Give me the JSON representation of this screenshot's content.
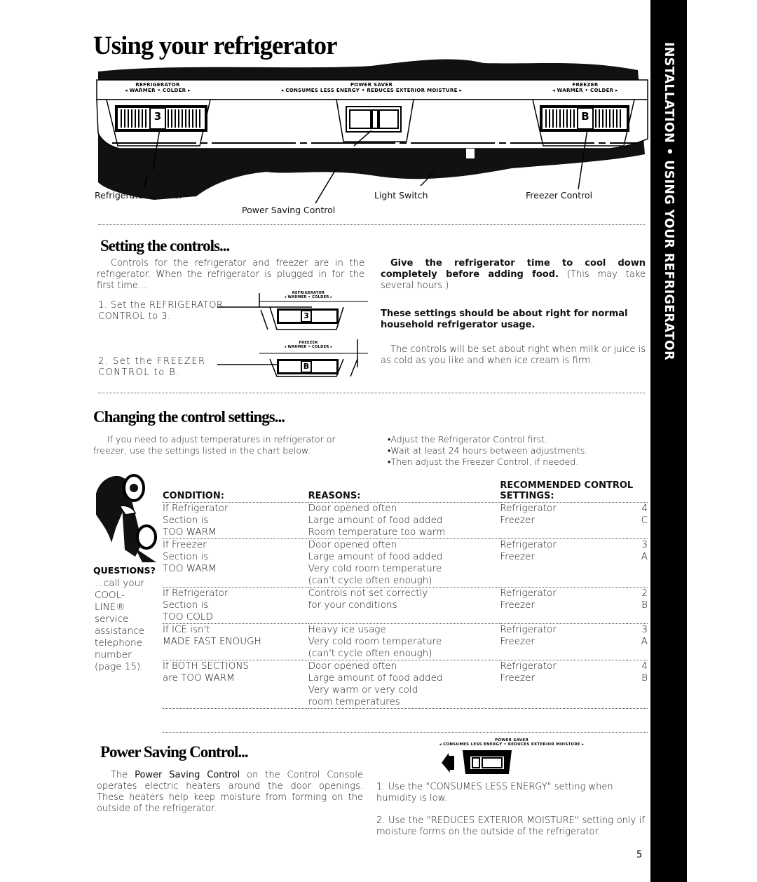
{
  "page_title": "Using your refrigerator",
  "side_tab": "INSTALLATION • USING YOUR REFRIGERATOR",
  "page_number": "5",
  "console": {
    "refrigerator_label": "REFRIGERATOR",
    "refrigerator_scale": "◂ WARMER • COLDER ▸",
    "refrigerator_setting": "3",
    "power_saver_label": "POWER SAVER",
    "power_saver_scale": "◂ CONSUMES LESS ENERGY • REDUCES EXTERIOR MOISTURE ▸",
    "freezer_label": "FREEZER",
    "freezer_scale": "◂ WARMER • COLDER ▸",
    "freezer_setting": "B",
    "callouts": {
      "refrigerator_control": "Refrigerator Control",
      "power_saving_control": "Power Saving Control",
      "light_switch": "Light Switch",
      "freezer_control": "Freezer Control"
    }
  },
  "setting_controls": {
    "heading": "Setting the controls...",
    "intro": "Controls for the refrigerator and freezer are in the refrigerator. When the refrigerator is plugged in for the first time...",
    "step1": "1. Set the REFRIGERATOR CONTROL to 3.",
    "step2": "2. Set the FREEZER CONTROL to B.",
    "mini_refrigerator_label": "REFRIGERATOR",
    "mini_refrigerator_scale": "◂ WARMER • COLDER ▸",
    "mini_refrigerator_value": "3",
    "mini_freezer_label": "FREEZER",
    "mini_freezer_scale": "◂ WARMER • COLDER ▸",
    "mini_freezer_value": "B",
    "cool_down_bold": "Give the refrigerator time to cool down completely before adding food.",
    "cool_down_note": "(This may take several hours.)",
    "normal_usage": "These settings should be about right for normal household refrigerator usage.",
    "check_note": "The controls will be set about right when milk or juice is as cold as you like and when ice cream is firm."
  },
  "changing_settings": {
    "heading": "Changing the control settings...",
    "intro": "If you need to adjust temperatures in refrigerator or freezer, use the settings listed in the chart below.",
    "bullets": [
      "Adjust the Refrigerator Control first.",
      "Wait at least 24 hours between adjustments.",
      "Then adjust the Freezer Control, if needed."
    ]
  },
  "questions": {
    "heading": "QUESTIONS?",
    "text": "...call your COOL-LINE® service assistance telephone number (page 15)."
  },
  "chart_data": {
    "type": "table",
    "columns": [
      "CONDITION:",
      "REASONS:",
      "RECOMMENDED CONTROL SETTINGS:",
      ""
    ],
    "rows": [
      {
        "condition": [
          "If Refrigerator",
          "Section is",
          "TOO WARM"
        ],
        "reasons": [
          "Door opened often",
          "Large amount of food added",
          "Room temperature too warm"
        ],
        "settings": [
          [
            "Refrigerator",
            "4"
          ],
          [
            "Freezer",
            "C"
          ]
        ]
      },
      {
        "condition": [
          "If Freezer",
          "Section is",
          "TOO WARM"
        ],
        "reasons": [
          "Door opened often",
          "Large amount of food added",
          "Very cold room temperature",
          "(can't cycle often enough)"
        ],
        "settings": [
          [
            "Refrigerator",
            "3"
          ],
          [
            "Freezer",
            "A"
          ]
        ]
      },
      {
        "condition": [
          "If Refrigerator",
          "Section is",
          "TOO COLD"
        ],
        "reasons": [
          "Controls not set correctly",
          "for your conditions"
        ],
        "settings": [
          [
            "Refrigerator",
            "2"
          ],
          [
            "Freezer",
            "B"
          ]
        ]
      },
      {
        "condition": [
          "If ICE isn't",
          "MADE FAST ENOUGH"
        ],
        "reasons": [
          "Heavy ice usage",
          "Very cold room temperature",
          "(can't cycle often enough)"
        ],
        "settings": [
          [
            "Refrigerator",
            "3"
          ],
          [
            "Freezer",
            "A"
          ]
        ]
      },
      {
        "condition": [
          "If BOTH SECTIONS",
          "are TOO WARM"
        ],
        "reasons": [
          "Door opened often",
          "Large amount of food added",
          "Very warm or very cold",
          "room temperatures"
        ],
        "settings": [
          [
            "Refrigerator",
            "4"
          ],
          [
            "Freezer",
            "B"
          ]
        ]
      }
    ]
  },
  "power_saving": {
    "heading": "Power Saving Control...",
    "intro_prefix": "The ",
    "intro_bold": "Power Saving Control",
    "intro_rest": " on the Control Console operates electric heaters around the door openings. These heaters help keep moisture from forming on the outside of the refrigerator.",
    "mini_label": "POWER SAVER",
    "mini_scale": "◂ CONSUMES LESS ENERGY • REDUCES EXTERIOR MOISTURE ▸",
    "step1": "1. Use the \"CONSUMES LESS ENERGY\" setting when humidity is low.",
    "step2": "2. Use the \"REDUCES EXTERIOR MOISTURE\" setting only if moisture forms on the outside of the refrigerator."
  }
}
